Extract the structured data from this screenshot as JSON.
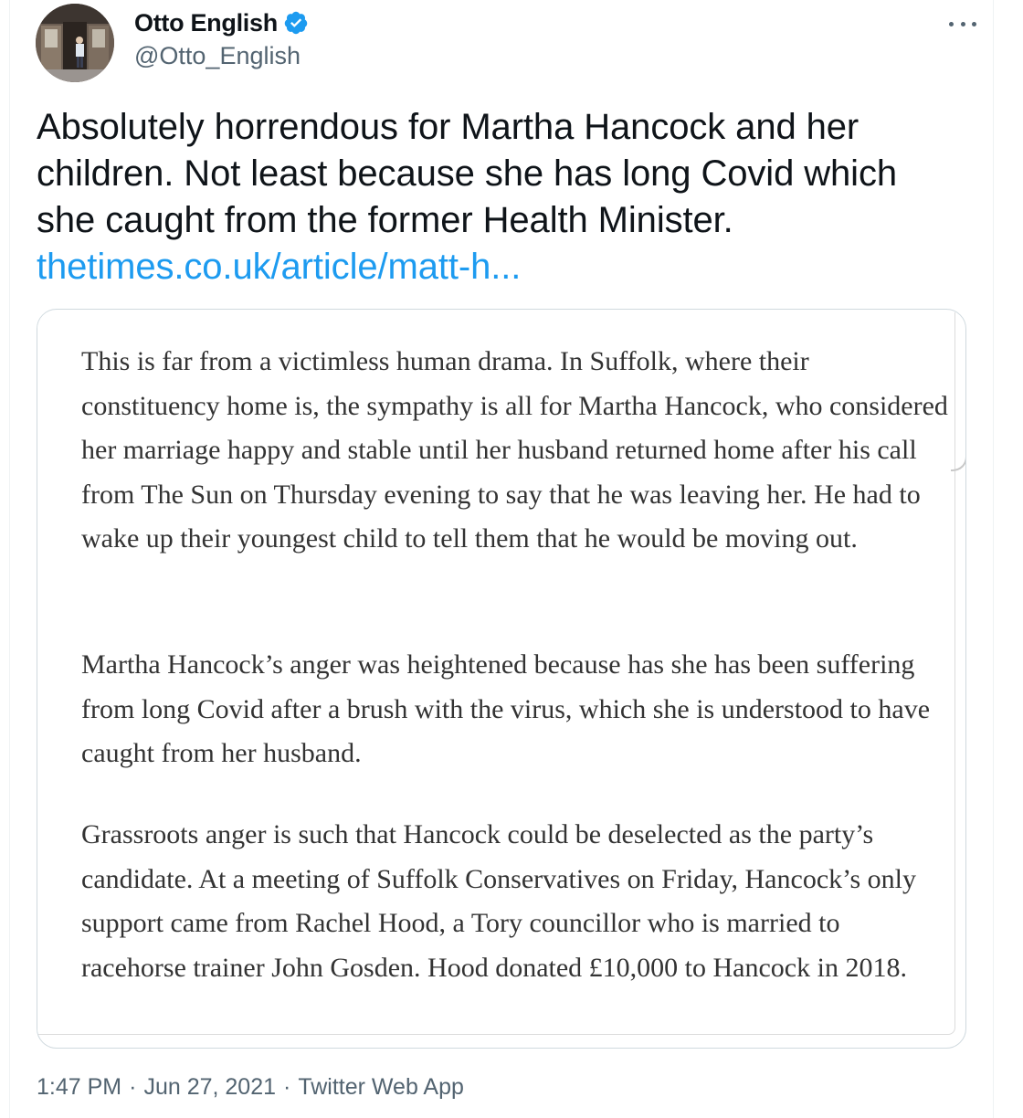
{
  "author": {
    "display_name": "Otto English",
    "handle": "@Otto_English",
    "verified": true
  },
  "colors": {
    "text": "#0f1419",
    "secondary": "#536471",
    "link": "#1d9bf0",
    "verified_badge": "#1d9bf0",
    "article_text": "#333333"
  },
  "icons": {
    "more": "more-horizontal-icon",
    "verified": "verified-badge-icon"
  },
  "tweet": {
    "text": "Absolutely horrendous for Martha Hancock and her children. Not least because she has long Covid which she caught from the former Health Minister.",
    "link": "thetimes.co.uk/article/matt-h..."
  },
  "media": {
    "paragraphs": [
      "This is far from a victimless human drama. In Suffolk, where their constituency home is, the sympathy is all for Martha Hancock, who considered her marriage happy and stable until her husband returned home after his call from The Sun on Thursday evening to say that he was leaving her. He had to wake up their youngest child to tell them that he would be moving out.",
      "Martha Hancock’s anger was heightened because has she has been suffering from long Covid after a brush with the virus, which she is understood to have caught from her husband.",
      "Grassroots anger is such that Hancock could be deselected as the party’s candidate. At a meeting of Suffolk Conservatives on Friday, Hancock’s only support came from Rachel Hood, a Tory councillor who is married to racehorse trainer John Gosden. Hood donated £10,000 to Hancock in 2018."
    ]
  },
  "meta": {
    "time": "1:47 PM",
    "date": "Jun 27, 2021",
    "source": "Twitter Web App",
    "separator": "·"
  }
}
